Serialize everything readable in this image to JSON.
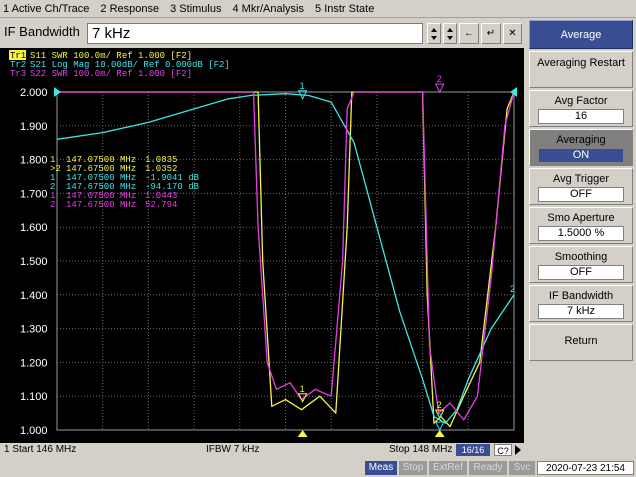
{
  "menu": [
    "1 Active Ch/Trace",
    "2 Response",
    "3 Stimulus",
    "4 Mkr/Analysis",
    "5 Instr State"
  ],
  "entry": {
    "label": "IF Bandwidth",
    "value": "7 kHz",
    "left_arrow": "←",
    "enter": "↵",
    "close": "✕"
  },
  "trace_headers": [
    {
      "id": "Tr1",
      "text": "S11  SWR 100.0m/ Ref 1.000 [F2]",
      "color": "#f5f542"
    },
    {
      "id": "Tr2",
      "text": "S21  Log Mag 10.00dB/ Ref 0.000dB [F2]",
      "color": "#3ce6e6"
    },
    {
      "id": "Tr3",
      "text": "S22  SWR 100.0m/ Ref 1.000 [F2]",
      "color": "#e640e6"
    }
  ],
  "y_ticks": [
    "2.000",
    "1.900",
    "1.800",
    "1.700",
    "1.600",
    "1.500",
    "1.400",
    "1.300",
    "1.200",
    "1.100",
    "1.000"
  ],
  "marker_table": [
    {
      "num": "1",
      "freq": "147.07500 MHz",
      "val": "1.0835",
      "color": "#f5f542"
    },
    {
      "num": ">2",
      "freq": "147.67500 MHz",
      "val": "1.0352",
      "color": "#f5f542"
    },
    {
      "num": "1",
      "freq": "147.07500 MHz",
      "val": "-1.9041 dB",
      "color": "#3ce6e6"
    },
    {
      "num": "2",
      "freq": "147.67500 MHz",
      "val": "-94.170 dB",
      "color": "#3ce6e6"
    },
    {
      "num": "1",
      "freq": "147.07500 MHz",
      "val": "1.0443",
      "color": "#e640e6"
    },
    {
      "num": "2",
      "freq": "147.67500 MHz",
      "val": "52.794",
      "color": "#e640e6"
    }
  ],
  "chart_data": {
    "type": "line",
    "x_unit": "MHz",
    "xlim": [
      146,
      148
    ],
    "ylim": [
      1.0,
      2.0
    ],
    "series": [
      {
        "name": "Tr1 S11 SWR",
        "color": "#f5f542",
        "x": [
          146.0,
          146.88,
          146.9,
          146.94,
          147.0,
          147.07,
          147.15,
          147.22,
          147.27,
          147.29,
          147.3,
          147.6,
          147.62,
          147.65,
          147.68,
          147.72,
          147.78,
          147.85,
          147.92,
          147.97,
          148.0
        ],
        "y": [
          2.0,
          2.0,
          1.5,
          1.07,
          1.09,
          1.06,
          1.1,
          1.05,
          1.6,
          2.0,
          2.0,
          2.0,
          1.4,
          1.02,
          1.04,
          1.01,
          1.1,
          1.2,
          1.6,
          1.95,
          2.0
        ]
      },
      {
        "name": "Tr2 S21 Log Mag",
        "color": "#3ce6e6",
        "x": [
          146.0,
          146.2,
          146.4,
          146.6,
          146.75,
          146.85,
          147.0,
          147.1,
          147.2,
          147.3,
          147.4,
          147.5,
          147.6,
          147.65,
          147.7,
          147.75,
          147.8,
          147.9,
          148.0
        ],
        "y": [
          1.86,
          1.88,
          1.91,
          1.95,
          1.98,
          1.99,
          1.995,
          1.99,
          1.97,
          1.85,
          1.6,
          1.35,
          1.15,
          1.04,
          1.02,
          1.06,
          1.15,
          1.3,
          1.4
        ]
      },
      {
        "name": "Tr3 S22 SWR",
        "color": "#e640e6",
        "x": [
          146.0,
          146.86,
          146.88,
          146.92,
          146.96,
          147.02,
          147.07,
          147.13,
          147.2,
          147.25,
          147.27,
          147.3,
          147.6,
          147.63,
          147.67,
          147.72,
          147.78,
          147.84,
          147.9,
          147.96,
          148.0
        ],
        "y": [
          2.0,
          2.0,
          1.6,
          1.2,
          1.12,
          1.14,
          1.09,
          1.12,
          1.1,
          1.5,
          1.95,
          2.0,
          2.0,
          1.25,
          1.05,
          1.08,
          1.03,
          1.1,
          1.45,
          1.9,
          2.0
        ]
      }
    ],
    "markers": [
      {
        "label": "1",
        "x": 147.075,
        "y": 1.0835,
        "color": "#f5f542"
      },
      {
        "label": "2",
        "x": 147.675,
        "y": 1.0352,
        "color": "#f5f542"
      },
      {
        "label": "1",
        "x": 147.075,
        "y": 1.98,
        "color": "#3ce6e6"
      },
      {
        "label": "2",
        "x": 147.675,
        "y": 1.0,
        "color": "#3ce6e6"
      },
      {
        "label": "2",
        "x": 147.675,
        "y": 2.0,
        "color": "#e640e6"
      }
    ],
    "grid": true
  },
  "channel": {
    "start": "1  Start 146 MHz",
    "ifbw": "IFBW 7 kHz",
    "stop": "Stop 148 MHz",
    "count": "16/16",
    "corr": "C?"
  },
  "status": {
    "meas": "Meas",
    "stop": "Stop",
    "extref": "ExtRef",
    "ready": "Ready",
    "svc": "Svc",
    "datetime": "2020-07-23 21:54"
  },
  "softkeys": {
    "title": "Average",
    "restart": "Averaging Restart",
    "factor_label": "Avg Factor",
    "factor_value": "16",
    "averaging_label": "Averaging",
    "averaging_value": "ON",
    "trigger_label": "Avg Trigger",
    "trigger_value": "OFF",
    "smo_label": "Smo Aperture",
    "smo_value": "1.5000  %",
    "smoothing_label": "Smoothing",
    "smoothing_value": "OFF",
    "ifbw_label": "IF Bandwidth",
    "ifbw_value": "7 kHz",
    "return": "Return"
  }
}
